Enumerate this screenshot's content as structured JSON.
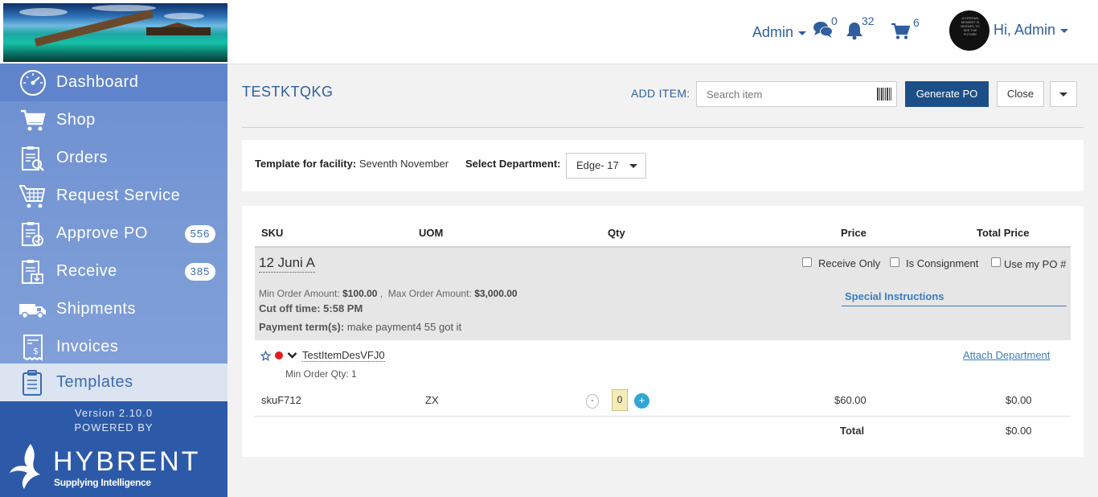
{
  "topbar": {
    "admin_label": "Admin",
    "messages_count": "0",
    "notifications_count": "32",
    "cart_count": "6",
    "greeting": "Hi, Admin",
    "avatar_text": "A CERTAIN MOMENT IS NEEDED TO SEE THE FUTURE",
    "accent_color": "#2f5f9e"
  },
  "sidebar": {
    "items": [
      {
        "label": "Dashboard",
        "icon": "dashboard-icon"
      },
      {
        "label": "Shop",
        "icon": "cart-icon"
      },
      {
        "label": "Orders",
        "icon": "orders-icon"
      },
      {
        "label": "Request Service",
        "icon": "request-service-icon"
      },
      {
        "label": "Approve PO",
        "icon": "approve-po-icon",
        "badge": "556"
      },
      {
        "label": "Receive",
        "icon": "receive-icon",
        "badge": "385"
      },
      {
        "label": "Shipments",
        "icon": "truck-icon"
      },
      {
        "label": "Invoices",
        "icon": "invoice-icon"
      },
      {
        "label": "Templates",
        "icon": "templates-icon",
        "active": true
      }
    ],
    "version": "Version 2.10.0",
    "powered_by": "POWERED BY",
    "brand": "HYBRENT",
    "tagline": "Supplying Intelligence"
  },
  "header": {
    "title": "TESTKTQKG",
    "add_item_label": "ADD ITEM:",
    "search_placeholder": "Search item",
    "generate_label": "Generate PO",
    "close_label": "Close"
  },
  "facility": {
    "label": "Template for facility:",
    "value": "Seventh November",
    "dept_label": "Select Department:",
    "dept_value": "Edge- 17"
  },
  "table": {
    "columns": [
      "SKU",
      "UOM",
      "Qty",
      "Price",
      "Total Price"
    ],
    "vendor": {
      "name": "12 Juni A",
      "receive_only": "Receive Only",
      "is_consignment": "Is Consignment",
      "use_my_po": "Use my PO #",
      "min_label": "Min Order Amount:",
      "min_value": "$100.00",
      "max_label": "Max Order Amount:",
      "max_value": "$3,000.00",
      "cutoff": "Cut off time: 5:58 PM",
      "payment_label": "Payment term(s):",
      "payment_value": "make payment4 55 got it",
      "special_instructions": "Special Instructions"
    },
    "item": {
      "name": "TestItemDesVFJ0",
      "min_qty": "Min Order Qty: 1",
      "attach_department": "Attach Department",
      "sku": "skuF712",
      "uom": "ZX",
      "qty": "0",
      "price": "$60.00",
      "total_price": "$0.00"
    },
    "total_label": "Total",
    "total_value": "$0.00"
  }
}
